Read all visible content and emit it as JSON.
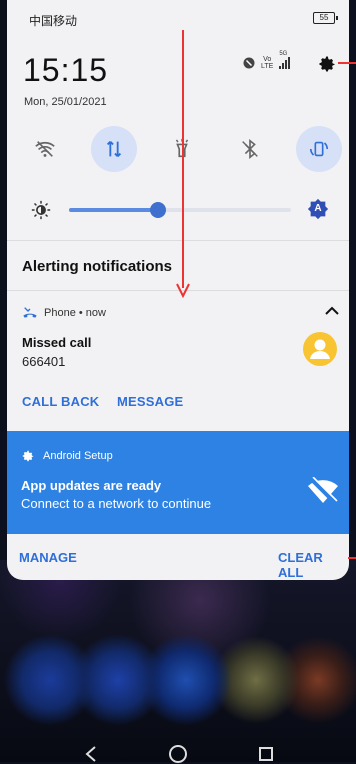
{
  "status": {
    "carrier": "中国移动",
    "battery": "55"
  },
  "header": {
    "time": "15:15",
    "date": "Mon, 25/01/2021",
    "net1": "Vo",
    "net2": "LTE",
    "net3": "5G"
  },
  "quick_settings": [
    {
      "name": "wifi-icon",
      "on": false
    },
    {
      "name": "data-transfer-icon",
      "on": true
    },
    {
      "name": "flashlight-icon",
      "on": false
    },
    {
      "name": "bluetooth-icon",
      "on": false
    },
    {
      "name": "auto-rotate-icon",
      "on": true
    }
  ],
  "brightness": {
    "level": 0.4,
    "auto_label": "A"
  },
  "section": {
    "title": "Alerting notifications"
  },
  "phone_notif": {
    "app": "Phone • now",
    "title": "Missed call",
    "number": "666401",
    "actions": [
      "CALL BACK",
      "MESSAGE"
    ]
  },
  "setup_notif": {
    "app": "Android Setup",
    "title": "App updates are ready",
    "text": "Connect to a network to continue"
  },
  "footer": {
    "manage": "MANAGE",
    "clear_all": "CLEAR ALL"
  },
  "colors": {
    "accent": "#2f6fd8",
    "setup_bg": "#2d82e4",
    "avatar": "#f8c431",
    "annotation": "#e33333"
  }
}
